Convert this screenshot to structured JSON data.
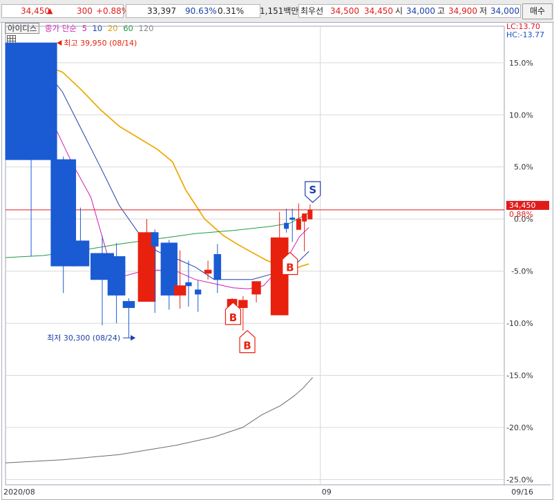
{
  "topbar": {
    "price": "34,450",
    "arrow": "▲",
    "change": "300",
    "change_pct": "+0.88%",
    "volume": "33,397",
    "volume_ratio": "90.63%",
    "turnover": "0.31%",
    "amount": "1,151백만",
    "best_label": "최우선",
    "best_ask": "34,500",
    "best_bid": "34,450",
    "open_label": "시",
    "open": "34,000",
    "high_label": "고",
    "high": "34,900",
    "low_label": "저",
    "low": "34,000",
    "buy_label": "매수"
  },
  "legend": {
    "stock": "아이디스",
    "ma_label": "종가 단순",
    "ma5": "5",
    "ma10": "10",
    "ma20": "20",
    "ma60": "60",
    "ma120": "120"
  },
  "lc": "LC:13.70",
  "hc": "HC:-13.77",
  "colors": {
    "up": "#e8200e",
    "down": "#1a5bd4",
    "ma5": "#d21ab0",
    "ma10": "#213fa8",
    "ma20": "#f0aa08",
    "ma60": "#1d9a3c",
    "ma120": "#6a6a6a",
    "ref_line": "#e11b1b",
    "grid": "#d8d8d8"
  },
  "chart_data": {
    "type": "candlestick",
    "y_unit": "%",
    "ylim": [
      -25.5,
      18.5
    ],
    "y_ticks": [
      15,
      10,
      5,
      0,
      -5,
      -10,
      -15,
      -20,
      -25
    ],
    "y_tick_labels": [
      "15.0%",
      "10.0%",
      "5.0%",
      "0.0%",
      "-5.0%",
      "-10.0%",
      "-15.0%",
      "-20.0%",
      "-25.0%"
    ],
    "x_labels": [
      {
        "index": 0,
        "label": "2020/08"
      },
      {
        "index": 16.6,
        "label": "09"
      },
      {
        "index": 25.8,
        "label": "09/16"
      }
    ],
    "current": {
      "label": "34,450",
      "pct_label": "0.88%",
      "value": 0.88
    },
    "candles": [
      {
        "o": 16.9,
        "h": 16.9,
        "c": 5.7,
        "l": -3.6
      },
      {
        "o": 5.7,
        "h": 6.0,
        "c": -4.5,
        "l": -7.1
      },
      {
        "o": -2.1,
        "h": 1.1,
        "c": -4.5,
        "l": -4.5
      },
      {
        "o": -3.3,
        "h": -1.6,
        "c": -5.8,
        "l": -10.2
      },
      {
        "o": -3.6,
        "h": -2.3,
        "c": -7.3,
        "l": -10.0
      },
      {
        "o": -7.9,
        "h": -7.6,
        "c": -8.5,
        "l": -11.4
      },
      {
        "o": -7.9,
        "h": 0.0,
        "c": -1.3,
        "l": -7.9
      },
      {
        "o": -1.3,
        "h": -1.0,
        "c": -2.6,
        "l": -9.0
      },
      {
        "o": -2.3,
        "h": -2.0,
        "c": -7.3,
        "l": -8.7
      },
      {
        "o": -7.3,
        "h": -3.0,
        "c": -6.4,
        "l": -8.6
      },
      {
        "o": -6.1,
        "h": -4.0,
        "c": -6.4,
        "l": -8.4
      },
      {
        "o": -6.8,
        "h": -5.9,
        "c": -7.2,
        "l": -8.9
      },
      {
        "o": -5.2,
        "h": -4.0,
        "c": -4.9,
        "l": -5.8
      },
      {
        "o": -3.4,
        "h": -2.4,
        "c": -5.8,
        "l": -7.1
      },
      {
        "o": -9.9,
        "h": -7.6,
        "c": -7.7,
        "l": -9.9
      },
      {
        "o": -8.5,
        "h": -7.4,
        "c": -7.8,
        "l": -10.7
      },
      {
        "o": -7.2,
        "h": -6.8,
        "c": -6.0,
        "l": -8.0
      },
      {
        "o": -9.2,
        "h": 0.7,
        "c": -1.8,
        "l": -9.2
      },
      {
        "o": -0.4,
        "h": 1.0,
        "c": -0.9,
        "l": -1.3
      },
      {
        "o": 0.1,
        "h": 1.0,
        "c": 0.0,
        "l": -2.2
      },
      {
        "o": -1.0,
        "h": 1.5,
        "c": 0.0,
        "l": -1.0
      },
      {
        "o": -0.2,
        "h": 0.1,
        "c": 0.5,
        "l": -3.1
      },
      {
        "o": 0.0,
        "h": 1.4,
        "c": 0.88,
        "l": 0.0
      }
    ],
    "candle_x": [
      0.0,
      2.4,
      3.5,
      4.5,
      5.4,
      6.2,
      7.0,
      7.7,
      8.2,
      8.9,
      9.5,
      10.0,
      10.5,
      11.0,
      11.7,
      12.3,
      13.0,
      14.0,
      14.7,
      15.0,
      15.35,
      15.65,
      15.95
    ],
    "candle_w": [
      2.7,
      1.3,
      0.9,
      1.2,
      0.9,
      0.6,
      0.9,
      0.35,
      0.85,
      0.6,
      0.3,
      0.3,
      0.35,
      0.35,
      0.5,
      0.45,
      0.45,
      0.9,
      0.15,
      0.25,
      0.2,
      0.2,
      0.2
    ],
    "series": [
      {
        "name": "5",
        "key": "ma5",
        "points": [
          [
            2.4,
            9.6
          ],
          [
            3.5,
            5.4
          ],
          [
            4.5,
            2.1
          ],
          [
            5.4,
            -3.6
          ],
          [
            6.0,
            -5.6
          ],
          [
            7.0,
            -5.1
          ],
          [
            8.0,
            -4.9
          ],
          [
            9.0,
            -5.0
          ],
          [
            10.0,
            -5.8
          ],
          [
            11.0,
            -6.2
          ],
          [
            12.0,
            -6.6
          ],
          [
            12.8,
            -6.7
          ],
          [
            13.6,
            -6.4
          ],
          [
            14.3,
            -5.0
          ],
          [
            15.0,
            -3.3
          ],
          [
            15.5,
            -1.7
          ],
          [
            16.0,
            -0.8
          ]
        ]
      },
      {
        "name": "10",
        "key": "ma10",
        "points": [
          [
            2.0,
            14.5
          ],
          [
            3.0,
            12.2
          ],
          [
            4.0,
            8.6
          ],
          [
            5.0,
            5.0
          ],
          [
            6.0,
            1.3
          ],
          [
            7.0,
            -1.3
          ],
          [
            8.0,
            -3.1
          ],
          [
            9.0,
            -3.8
          ],
          [
            10.0,
            -4.6
          ],
          [
            11.0,
            -5.8
          ],
          [
            12.0,
            -5.8
          ],
          [
            13.0,
            -5.8
          ],
          [
            14.0,
            -5.3
          ],
          [
            15.0,
            -4.8
          ],
          [
            15.5,
            -4.0
          ],
          [
            16.0,
            -3.1
          ]
        ]
      },
      {
        "name": "20",
        "key": "ma20",
        "points": [
          [
            2.0,
            14.8
          ],
          [
            3.0,
            14.1
          ],
          [
            4.0,
            12.4
          ],
          [
            5.0,
            10.5
          ],
          [
            6.0,
            8.9
          ],
          [
            7.0,
            7.8
          ],
          [
            8.0,
            6.7
          ],
          [
            8.8,
            5.5
          ],
          [
            9.5,
            2.8
          ],
          [
            10.5,
            0.0
          ],
          [
            11.5,
            -1.6
          ],
          [
            12.3,
            -2.5
          ],
          [
            13.0,
            -3.2
          ],
          [
            13.8,
            -4.0
          ],
          [
            14.6,
            -4.5
          ],
          [
            15.3,
            -4.7
          ],
          [
            16.0,
            -4.3
          ]
        ]
      },
      {
        "name": "60",
        "key": "ma60",
        "points": [
          [
            0.0,
            -3.7
          ],
          [
            2.0,
            -3.5
          ],
          [
            4.0,
            -3.0
          ],
          [
            6.0,
            -2.4
          ],
          [
            8.0,
            -1.9
          ],
          [
            10.0,
            -1.4
          ],
          [
            12.0,
            -1.1
          ],
          [
            14.0,
            -0.7
          ],
          [
            15.0,
            -0.4
          ],
          [
            16.0,
            0.6
          ]
        ]
      },
      {
        "name": "120",
        "key": "ma120",
        "points": [
          [
            0.0,
            -23.4
          ],
          [
            3.0,
            -23.1
          ],
          [
            6.0,
            -22.6
          ],
          [
            9.0,
            -21.7
          ],
          [
            11.0,
            -20.9
          ],
          [
            12.5,
            -20.0
          ],
          [
            13.5,
            -18.8
          ],
          [
            14.5,
            -17.9
          ],
          [
            15.2,
            -17.0
          ],
          [
            15.7,
            -16.2
          ],
          [
            16.2,
            -15.2
          ]
        ]
      }
    ],
    "annotations": [
      {
        "text": "최고 39,950 (08/14)",
        "arrow": "left",
        "x": 3.0,
        "y": 16.9,
        "color": "#e8200e"
      },
      {
        "text": "최저 30,300 (08/24)",
        "arrow": "right",
        "x": 7.0,
        "y": -11.4,
        "color": "#1a3fa8"
      }
    ],
    "signals": [
      {
        "label": "B",
        "x": 12.0,
        "y": -8.0,
        "color": "#e8200e"
      },
      {
        "label": "B",
        "x": 12.75,
        "y": -10.7,
        "color": "#e8200e"
      },
      {
        "label": "B",
        "x": 15.0,
        "y": -3.2,
        "color": "#e8200e"
      },
      {
        "label": "S",
        "x": 16.2,
        "y": 1.6,
        "color": "#1a3fa8"
      }
    ]
  }
}
